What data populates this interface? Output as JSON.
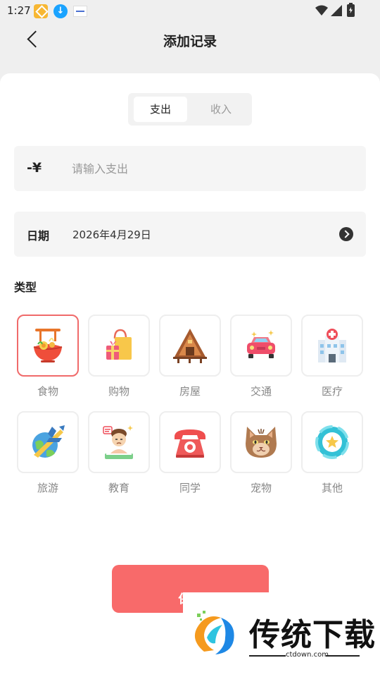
{
  "status_bar": {
    "time": "1:27",
    "icons": [
      "app-icon-1",
      "download-icon",
      "app-icon-3",
      "wifi-icon",
      "signal-icon",
      "battery-icon"
    ]
  },
  "header": {
    "title": "添加记录",
    "back_icon": "chevron-left-icon"
  },
  "segment": {
    "tabs": [
      {
        "label": "支出",
        "active": true
      },
      {
        "label": "收入",
        "active": false
      }
    ]
  },
  "amount": {
    "prefix": "-¥",
    "placeholder": "请输入支出",
    "value": ""
  },
  "date": {
    "label": "日期",
    "value": "2026年4月29日",
    "arrow_icon": "chevron-right-circle-icon"
  },
  "type_section": {
    "label": "类型",
    "categories": [
      {
        "name": "食物",
        "icon": "food-icon",
        "selected": true
      },
      {
        "name": "购物",
        "icon": "shopping-icon",
        "selected": false
      },
      {
        "name": "房屋",
        "icon": "house-icon",
        "selected": false
      },
      {
        "name": "交通",
        "icon": "car-icon",
        "selected": false
      },
      {
        "name": "医疗",
        "icon": "hospital-icon",
        "selected": false
      },
      {
        "name": "旅游",
        "icon": "plane-icon",
        "selected": false
      },
      {
        "name": "教育",
        "icon": "education-icon",
        "selected": false
      },
      {
        "name": "同学",
        "icon": "telephone-icon",
        "selected": false
      },
      {
        "name": "宠物",
        "icon": "cat-icon",
        "selected": false
      },
      {
        "name": "其他",
        "icon": "star-ring-icon",
        "selected": false
      }
    ]
  },
  "save_button": {
    "label": "保存"
  },
  "watermark": {
    "brand": "传统下载",
    "url": "ctdown.com"
  },
  "colors": {
    "accent": "#f86a6a",
    "selected_border": "#f06a6a",
    "background": "#efefef"
  }
}
